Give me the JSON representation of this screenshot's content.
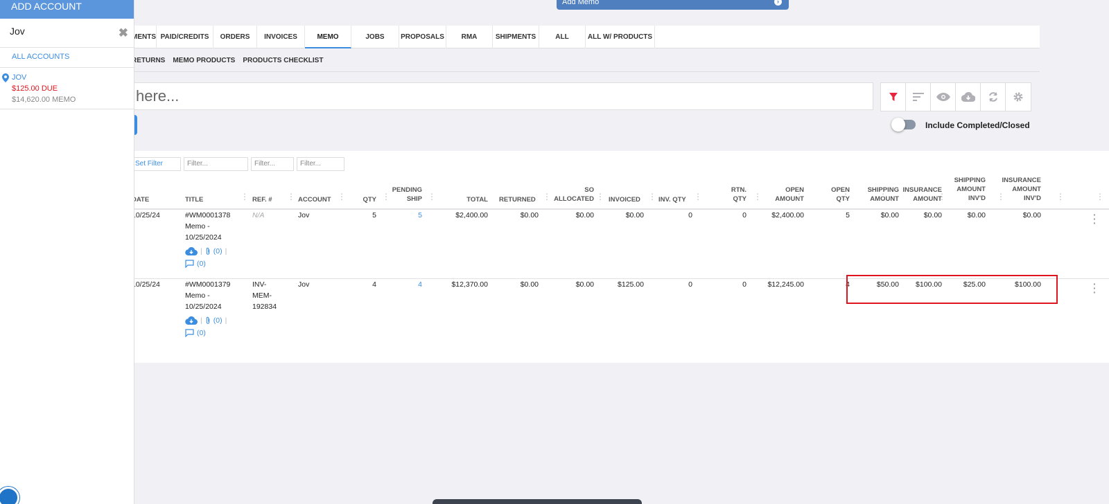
{
  "add_memo": {
    "label": "Add Memo"
  },
  "tabs": [
    {
      "label": "MENTS"
    },
    {
      "label": "PAID/CREDITS"
    },
    {
      "label": "ORDERS"
    },
    {
      "label": "INVOICES"
    },
    {
      "label": "MEMO"
    },
    {
      "label": "JOBS"
    },
    {
      "label": "PROPOSALS"
    },
    {
      "label": "RMA"
    },
    {
      "label": "SHIPMENTS"
    },
    {
      "label": "ALL"
    },
    {
      "label": "ALL W/ PRODUCTS"
    }
  ],
  "subtabs": [
    {
      "label": "RETURNS"
    },
    {
      "label": "MEMO PRODUCTS"
    },
    {
      "label": "PRODUCTS CHECKLIST"
    }
  ],
  "search": {
    "value": "here..."
  },
  "toolbar": {
    "filter_icon": "filter-icon",
    "sort_icon": "sort-icon",
    "view_icon": "eye-icon",
    "download_icon": "cloud-download-icon",
    "refresh_icon": "refresh-icon",
    "settings_icon": "gear-icon",
    "active_color": "#e8253e"
  },
  "toggle": {
    "label": "Include Completed/Closed",
    "on": false
  },
  "filters": [
    {
      "text": "Set Filter"
    },
    {
      "text": "Filter..."
    },
    {
      "text": "Filter..."
    },
    {
      "text": "Filter..."
    }
  ],
  "columns": {
    "date": "DATE",
    "title": "TITLE",
    "ref": "REF. #",
    "account": "ACCOUNT",
    "qty": "QTY",
    "pending_ship": [
      "PENDING",
      "SHIP"
    ],
    "total": "TOTAL",
    "returned": "RETURNED",
    "so_allocated": [
      "SO",
      "ALLOCATED"
    ],
    "invoiced": "INVOICED",
    "inv_qty": "INV. QTY",
    "rtn_qty": [
      "RTN.",
      "QTY"
    ],
    "open_amount": [
      "OPEN",
      "AMOUNT"
    ],
    "open_qty": [
      "OPEN",
      "QTY"
    ],
    "shipping_amount": [
      "SHIPPING",
      "AMOUNT"
    ],
    "insurance_amount": [
      "INSURANCE",
      "AMOUNT"
    ],
    "shipping_invd": [
      "SHIPPING",
      "AMOUNT",
      "INV'D"
    ],
    "insurance_invd": [
      "INSURANCE",
      "AMOUNT",
      "INV'D"
    ]
  },
  "rows": [
    {
      "date": "10/25/24",
      "title": [
        "#WM0001378",
        "Memo -",
        "10/25/2024"
      ],
      "ref": [
        "N/A"
      ],
      "account": "Jov",
      "qty": "5",
      "pending_ship": "5",
      "total": "$2,400.00",
      "returned": "$0.00",
      "so_allocated": "$0.00",
      "invoiced": "$0.00",
      "inv_qty": "0",
      "rtn_qty": "0",
      "open_amount": "$2,400.00",
      "open_qty": "5",
      "shipping_amount": "$0.00",
      "insurance_amount": "$0.00",
      "shipping_invd": "$0.00",
      "insurance_invd": "$0.00",
      "attach_count": "(0)",
      "comment_count": "(0)"
    },
    {
      "date": "10/25/24",
      "title": [
        "#WM0001379",
        "Memo -",
        "10/25/2024"
      ],
      "ref": [
        "INV-",
        "MEM-",
        "192834"
      ],
      "account": "Jov",
      "qty": "4",
      "pending_ship": "4",
      "total": "$12,370.00",
      "returned": "$0.00",
      "so_allocated": "$0.00",
      "invoiced": "$125.00",
      "inv_qty": "0",
      "rtn_qty": "0",
      "open_amount": "$12,245.00",
      "open_qty": "4",
      "shipping_amount": "$50.00",
      "insurance_amount": "$100.00",
      "shipping_invd": "$25.00",
      "insurance_invd": "$100.00",
      "attach_count": "(0)",
      "comment_count": "(0)"
    }
  ],
  "sidebar": {
    "add_account": "ADD ACCOUNT",
    "search_value": "Jov",
    "all_accounts": "ALL ACCOUNTS",
    "account": {
      "name": "JOV",
      "due": "$125.00 DUE",
      "memo": "$14,620.00 MEMO"
    }
  },
  "colors": {
    "accent": "#3b8de0",
    "highlight": "#e0141e",
    "due": "#e0141e"
  }
}
